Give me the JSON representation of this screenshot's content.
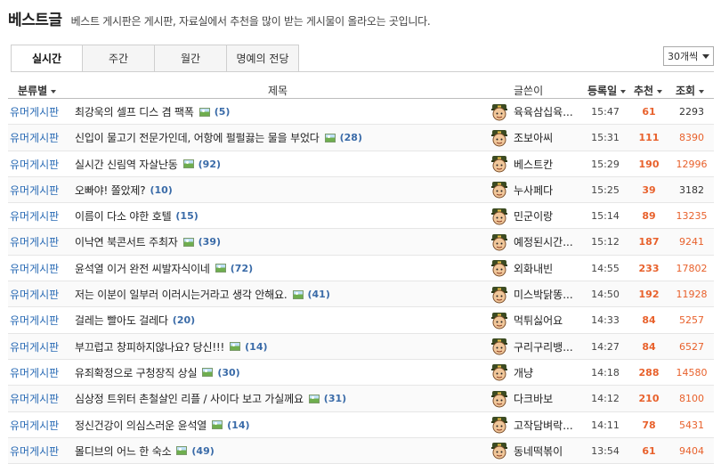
{
  "header": {
    "title": "베스트글",
    "description": "베스트 게시판은 게시판, 자료실에서 추천을 많이 받는 게시물이 올라오는 곳입니다."
  },
  "tabs": [
    {
      "label": "실시간",
      "active": true
    },
    {
      "label": "주간",
      "active": false
    },
    {
      "label": "월간",
      "active": false
    },
    {
      "label": "명예의 전당",
      "active": false
    }
  ],
  "per_page_select": {
    "value": "30개씩"
  },
  "table": {
    "headers": {
      "category": "분류별",
      "title": "제목",
      "author": "글쓴이",
      "date": "등록일",
      "recommend": "추천",
      "views": "조회"
    },
    "rows": [
      {
        "category": "유머게시판",
        "title": "최강욱의 셀프 디스 겸 팩폭",
        "has_image": true,
        "comments": "(5)",
        "author": "육육삼십육...",
        "time": "15:47",
        "recommend": "61",
        "views": "2293",
        "views_hot": false
      },
      {
        "category": "유머게시판",
        "title": "신입이 물고기 전문가인데, 어항에 펄펄끓는 물을 부었다",
        "has_image": true,
        "comments": "(28)",
        "author": "조보아씨",
        "time": "15:31",
        "recommend": "111",
        "views": "8390",
        "views_hot": true
      },
      {
        "category": "유머게시판",
        "title": "실시간 신림역 자살난동",
        "has_image": true,
        "comments": "(92)",
        "author": "베스트칸",
        "time": "15:29",
        "recommend": "190",
        "views": "12996",
        "views_hot": true
      },
      {
        "category": "유머게시판",
        "title": "오빠야! 쫄았제?",
        "has_image": false,
        "comments": "(10)",
        "author": "누사페다",
        "time": "15:25",
        "recommend": "39",
        "views": "3182",
        "views_hot": false
      },
      {
        "category": "유머게시판",
        "title": "이름이 다소 야한 호텔",
        "has_image": false,
        "comments": "(15)",
        "author": "민군이랑",
        "time": "15:14",
        "recommend": "89",
        "views": "13235",
        "views_hot": true
      },
      {
        "category": "유머게시판",
        "title": "이낙연 북콘서트 주최자",
        "has_image": true,
        "comments": "(39)",
        "author": "예정된시간...",
        "time": "15:12",
        "recommend": "187",
        "views": "9241",
        "views_hot": true
      },
      {
        "category": "유머게시판",
        "title": "윤석열 이거 완전 씨발자식이네",
        "has_image": true,
        "comments": "(72)",
        "author": "외화내빈",
        "time": "14:55",
        "recommend": "233",
        "views": "17802",
        "views_hot": true
      },
      {
        "category": "유머게시판",
        "title": "저는 이분이 일부러 이러시는거라고 생각 안해요.",
        "has_image": true,
        "comments": "(41)",
        "author": "미스박닭똥...",
        "time": "14:50",
        "recommend": "192",
        "views": "11928",
        "views_hot": true
      },
      {
        "category": "유머게시판",
        "title": "걸레는 빨아도 걸레다",
        "has_image": false,
        "comments": "(20)",
        "author": "먹튀싫어요",
        "time": "14:33",
        "recommend": "84",
        "views": "5257",
        "views_hot": true
      },
      {
        "category": "유머게시판",
        "title": "부끄럽고 창피하지않나요? 당신!!!",
        "has_image": true,
        "comments": "(14)",
        "author": "구리구리뱅...",
        "time": "14:27",
        "recommend": "84",
        "views": "6527",
        "views_hot": true
      },
      {
        "category": "유머게시판",
        "title": "유죄확정으로 구청장직 상실",
        "has_image": true,
        "comments": "(30)",
        "author": "개냥",
        "time": "14:18",
        "recommend": "288",
        "views": "14580",
        "views_hot": true
      },
      {
        "category": "유머게시판",
        "title": "심상정 트위터 촌철살인 리플 / 사이다 보고 가실께요",
        "has_image": true,
        "comments": "(31)",
        "author": "다크바보",
        "time": "14:12",
        "recommend": "210",
        "views": "8100",
        "views_hot": true
      },
      {
        "category": "유머게시판",
        "title": "정신건강이 의심스러운 윤석열",
        "has_image": true,
        "comments": "(14)",
        "author": "고작담벼락...",
        "time": "14:11",
        "recommend": "78",
        "views": "5431",
        "views_hot": true
      },
      {
        "category": "유머게시판",
        "title": "몰디브의 어느 한 숙소",
        "has_image": true,
        "comments": "(49)",
        "author": "동네떡볶이",
        "time": "13:54",
        "recommend": "61",
        "views": "9404",
        "views_hot": true
      }
    ]
  },
  "colors": {
    "category_link": "#2a6bb5",
    "recommend": "#e8612c",
    "comment_count": "#3a6ba8"
  }
}
